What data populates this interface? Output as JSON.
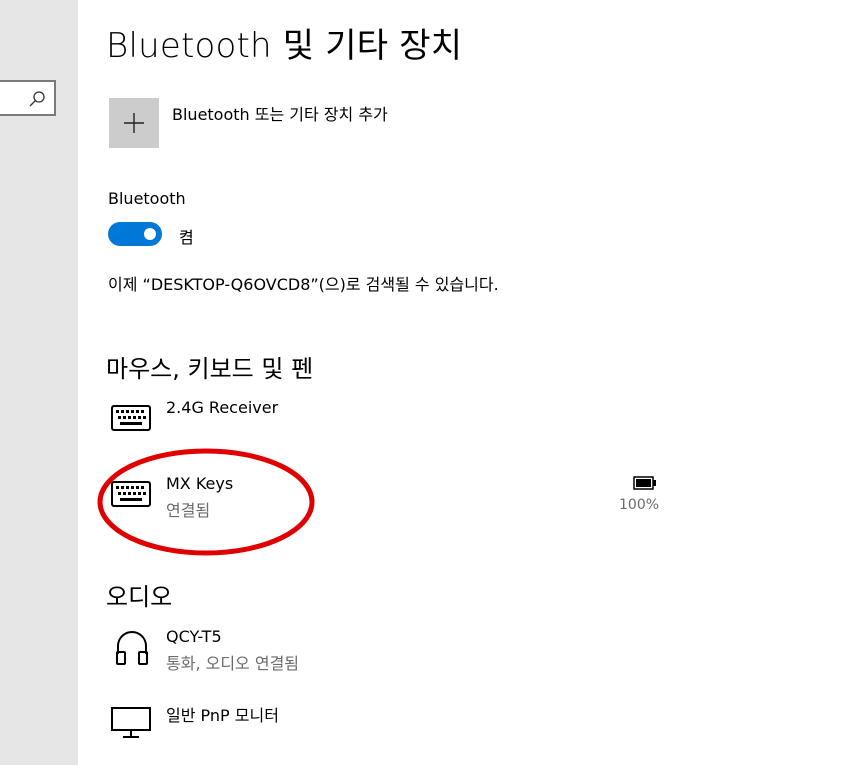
{
  "page": {
    "title": "Bluetooth 및 기타 장치"
  },
  "search": {
    "icon": "search-icon"
  },
  "add_device": {
    "label": "Bluetooth 또는 기타 장치 추가",
    "icon": "plus-icon"
  },
  "bluetooth": {
    "label": "Bluetooth",
    "toggle_state": "켬",
    "toggle_on": true,
    "discoverable_text": "이제 “DESKTOP-Q6OVCD8”(으)로 검색될 수 있습니다."
  },
  "sections": {
    "input": {
      "title": "마우스, 키보드 및 펜",
      "devices": [
        {
          "name": "2.4G Receiver",
          "status": "",
          "icon": "keyboard-icon"
        },
        {
          "name": "MX Keys",
          "status": "연결됨",
          "icon": "keyboard-icon",
          "battery": "100%",
          "battery_level": 1.0
        }
      ]
    },
    "audio": {
      "title": "오디오",
      "devices": [
        {
          "name": "QCY-T5",
          "status": "통화, 오디오 연결됨",
          "icon": "headphones-icon"
        },
        {
          "name": "일반 PnP 모니터",
          "status": "",
          "icon": "monitor-icon"
        }
      ]
    }
  },
  "colors": {
    "accent": "#0078d7",
    "annotation": "#e00000",
    "sidebar": "#e6e6e6",
    "tile": "#cccccc"
  }
}
